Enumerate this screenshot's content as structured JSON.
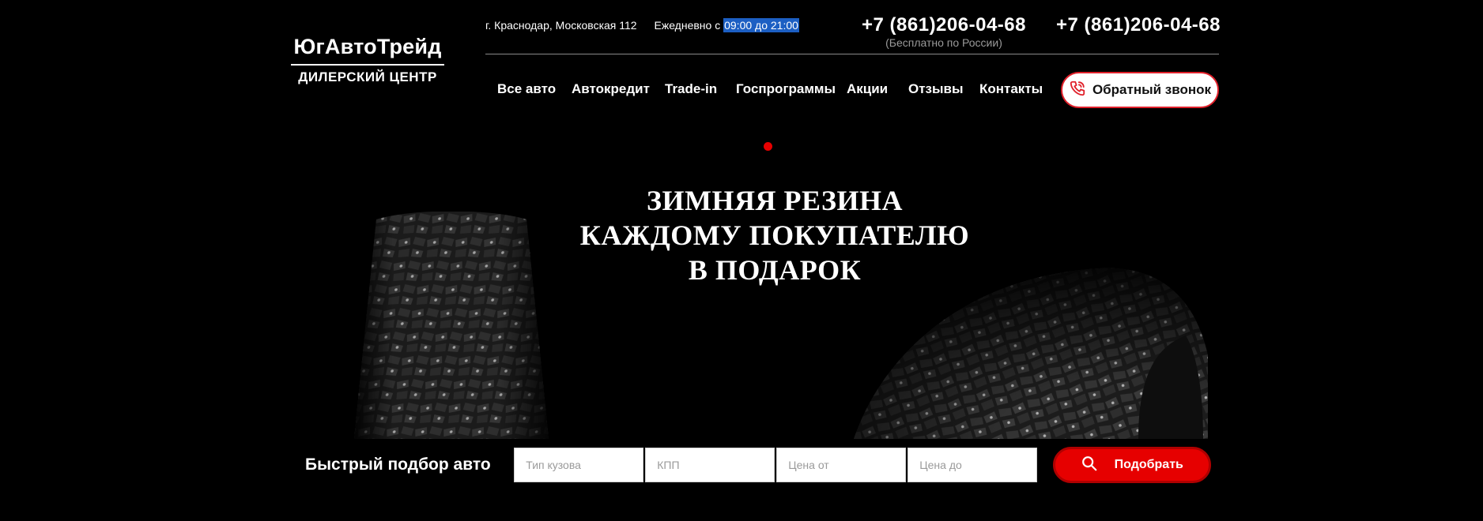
{
  "logo": {
    "name": "ЮгАвтоТрейд",
    "subtitle": "ДИЛЕРСКИЙ ЦЕНТР"
  },
  "topline": {
    "address": "г. Краснодар, Московская 112",
    "hours_label": "Ежедневно с ",
    "hours": "09:00 до 21:00"
  },
  "phones": [
    {
      "number": "+7 (861)206-04-68",
      "note": "(Бесплатно по России)"
    },
    {
      "number": "+7 (861)206-04-68"
    }
  ],
  "nav": {
    "items": [
      {
        "label": "Все авто"
      },
      {
        "label": "Автокредит"
      },
      {
        "label": "Trade-in"
      },
      {
        "label": "Госпрограммы"
      },
      {
        "label": "Акции"
      },
      {
        "label": "Отзывы"
      },
      {
        "label": "Контакты"
      }
    ]
  },
  "callback": {
    "label": "Обратный звонок",
    "icon": "phone-icon"
  },
  "banner": {
    "line1": "ЗИМНЯЯ РЕЗИНА",
    "line2": "КАЖДОМУ ПОКУПАТЕЛЮ",
    "line3": "В ПОДАРОК",
    "slide_indicator_color": "#e60000"
  },
  "search": {
    "title": "Быстрый подбор авто",
    "fields": [
      {
        "placeholder": "Тип кузова"
      },
      {
        "placeholder": "КПП"
      },
      {
        "placeholder": "Цена от"
      },
      {
        "placeholder": "Цена до"
      }
    ],
    "button_label": "Подобрать",
    "button_icon": "search-icon"
  },
  "colors": {
    "accent": "#e60000",
    "background": "#000000",
    "highlight": "#1c5fc3"
  }
}
